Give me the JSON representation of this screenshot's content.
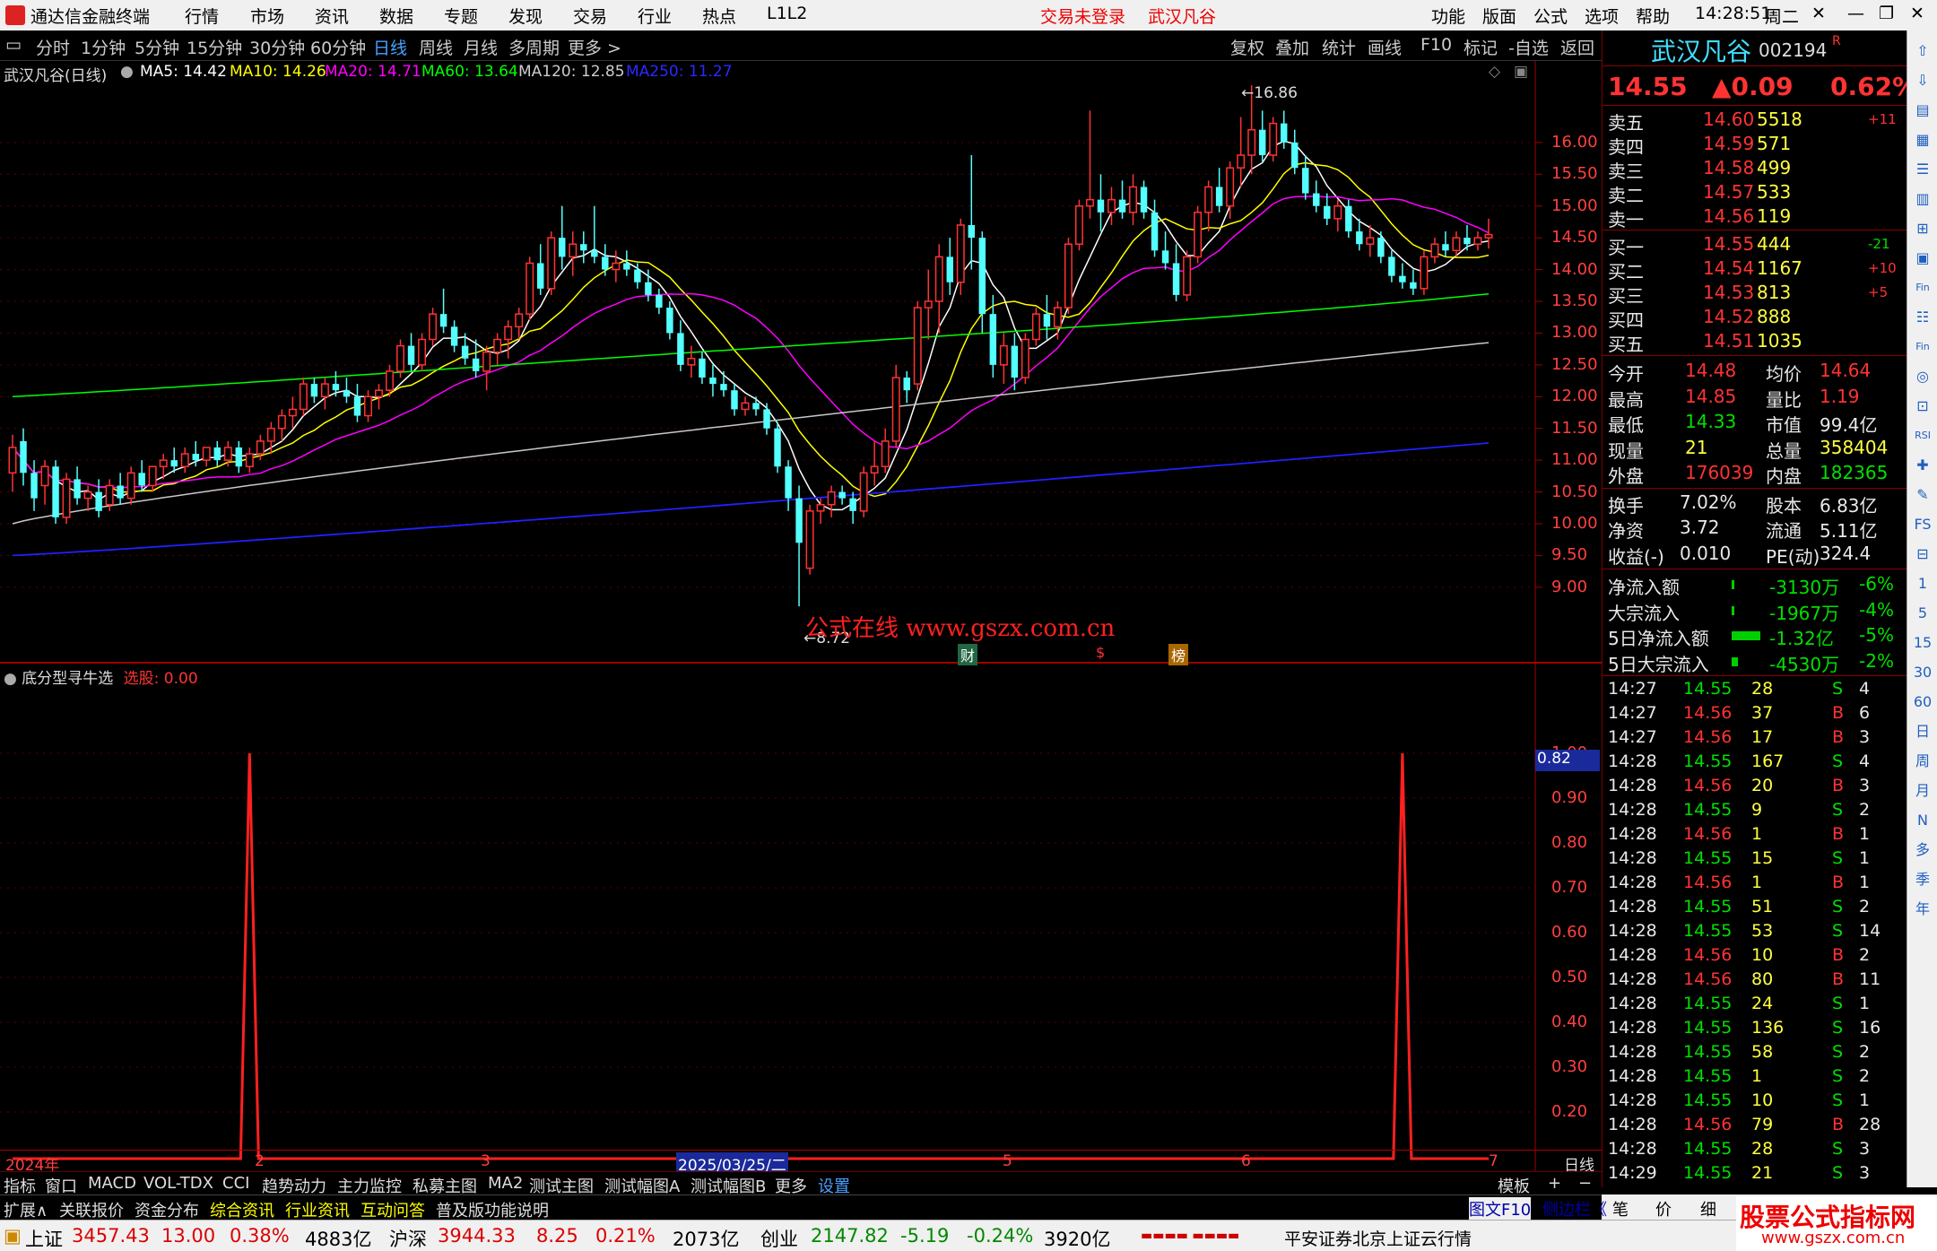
{
  "titlebar": {
    "app_name": "通达信金融终端",
    "menu": [
      "行情",
      "市场",
      "资讯",
      "数据",
      "专题",
      "发现",
      "交易",
      "行业",
      "热点",
      "L1L2"
    ],
    "login_status": "交易未登录",
    "stock_name": "武汉凡谷",
    "right_menu": [
      "功能",
      "版面",
      "公式",
      "选项",
      "帮助"
    ],
    "time": "14:28:51",
    "weekday": "周二"
  },
  "periodbar": {
    "items": [
      "分时",
      "1分钟",
      "5分钟",
      "15分钟",
      "30分钟",
      "60分钟",
      "日线",
      "周线",
      "月线",
      "多周期",
      "更多 >"
    ],
    "active": "日线",
    "right_items": [
      "复权",
      "叠加",
      "统计",
      "画线",
      "F10",
      "标记",
      "-自选",
      "返回"
    ]
  },
  "main_chart": {
    "label": "武汉凡谷(日线)",
    "ma": [
      {
        "text": "MA5: 14.42",
        "color": "#ffffff"
      },
      {
        "text": "MA10: 14.26",
        "color": "#ffff00"
      },
      {
        "text": "MA20: 14.71",
        "color": "#ff00ff"
      },
      {
        "text": "MA60: 13.64",
        "color": "#00ff00"
      },
      {
        "text": "MA120: 12.85",
        "color": "#c0c0c0"
      },
      {
        "text": "MA250: 11.27",
        "color": "#2020ff"
      }
    ],
    "high_label": "16.86",
    "low_label": "8.72",
    "watermark": "公式在线  www.gszx.com.cn",
    "markers": [
      "财",
      "$",
      "榜"
    ],
    "y_ticks": [
      "16.00",
      "15.50",
      "15.00",
      "14.50",
      "14.00",
      "13.50",
      "13.00",
      "12.50",
      "12.00",
      "11.50",
      "11.00",
      "10.50",
      "10.00",
      "9.50",
      "9.00"
    ],
    "candles": [
      [
        10.8,
        11.4,
        10.5,
        11.2
      ],
      [
        11.3,
        11.5,
        10.6,
        10.8
      ],
      [
        10.8,
        11.0,
        10.2,
        10.4
      ],
      [
        10.6,
        11.0,
        10.3,
        10.9
      ],
      [
        10.9,
        11.0,
        10.0,
        10.1
      ],
      [
        10.1,
        10.8,
        10.0,
        10.7
      ],
      [
        10.7,
        10.9,
        10.3,
        10.4
      ],
      [
        10.4,
        10.6,
        10.2,
        10.5
      ],
      [
        10.5,
        10.7,
        10.1,
        10.2
      ],
      [
        10.3,
        10.7,
        10.2,
        10.6
      ],
      [
        10.6,
        10.8,
        10.3,
        10.4
      ],
      [
        10.4,
        10.9,
        10.3,
        10.8
      ],
      [
        10.8,
        11.0,
        10.5,
        10.6
      ],
      [
        10.6,
        10.9,
        10.5,
        10.9
      ],
      [
        10.9,
        11.1,
        10.7,
        11.0
      ],
      [
        11.0,
        11.2,
        10.8,
        10.9
      ],
      [
        10.9,
        11.2,
        10.8,
        11.1
      ],
      [
        11.1,
        11.3,
        10.9,
        11.0
      ],
      [
        11.0,
        11.2,
        10.9,
        11.2
      ],
      [
        11.2,
        11.3,
        10.9,
        11.0
      ],
      [
        11.0,
        11.3,
        10.9,
        11.2
      ],
      [
        11.2,
        11.3,
        10.8,
        10.9
      ],
      [
        10.9,
        11.2,
        10.8,
        11.1
      ],
      [
        11.1,
        11.4,
        11.0,
        11.3
      ],
      [
        11.3,
        11.6,
        11.1,
        11.5
      ],
      [
        11.5,
        11.8,
        11.3,
        11.7
      ],
      [
        11.7,
        12.0,
        11.5,
        11.8
      ],
      [
        11.8,
        12.3,
        11.7,
        12.2
      ],
      [
        12.2,
        12.3,
        11.9,
        12.0
      ],
      [
        12.0,
        12.3,
        11.8,
        12.2
      ],
      [
        12.2,
        12.4,
        12.0,
        12.1
      ],
      [
        12.1,
        12.3,
        11.9,
        12.0
      ],
      [
        12.0,
        12.2,
        11.6,
        11.7
      ],
      [
        11.7,
        12.1,
        11.6,
        12.0
      ],
      [
        12.0,
        12.2,
        11.8,
        12.1
      ],
      [
        12.1,
        12.5,
        12.0,
        12.4
      ],
      [
        12.4,
        12.9,
        12.3,
        12.8
      ],
      [
        12.8,
        13.0,
        12.4,
        12.5
      ],
      [
        12.5,
        13.0,
        12.4,
        12.9
      ],
      [
        12.9,
        13.4,
        12.8,
        13.3
      ],
      [
        13.3,
        13.7,
        13.0,
        13.1
      ],
      [
        13.1,
        13.2,
        12.7,
        12.8
      ],
      [
        12.8,
        13.0,
        12.5,
        12.6
      ],
      [
        12.6,
        12.9,
        12.3,
        12.4
      ],
      [
        12.4,
        12.8,
        12.1,
        12.7
      ],
      [
        12.7,
        13.0,
        12.5,
        12.9
      ],
      [
        12.9,
        13.2,
        12.6,
        13.1
      ],
      [
        13.1,
        13.4,
        12.9,
        13.3
      ],
      [
        13.3,
        14.2,
        13.2,
        14.1
      ],
      [
        14.1,
        14.4,
        13.6,
        13.7
      ],
      [
        13.7,
        14.6,
        13.6,
        14.5
      ],
      [
        14.5,
        15.0,
        14.0,
        14.2
      ],
      [
        14.2,
        14.6,
        13.9,
        14.4
      ],
      [
        14.4,
        14.6,
        14.1,
        14.3
      ],
      [
        14.3,
        15.0,
        14.1,
        14.2
      ],
      [
        14.2,
        14.4,
        13.9,
        14.0
      ],
      [
        14.0,
        14.3,
        13.8,
        14.1
      ],
      [
        14.1,
        14.3,
        13.9,
        14.0
      ],
      [
        14.0,
        14.1,
        13.7,
        13.8
      ],
      [
        13.8,
        14.0,
        13.5,
        13.6
      ],
      [
        13.6,
        13.7,
        13.3,
        13.4
      ],
      [
        13.4,
        13.5,
        12.9,
        13.0
      ],
      [
        13.0,
        13.2,
        12.4,
        12.5
      ],
      [
        12.5,
        12.8,
        12.3,
        12.6
      ],
      [
        12.6,
        12.7,
        12.2,
        12.3
      ],
      [
        12.3,
        12.5,
        12.0,
        12.2
      ],
      [
        12.2,
        12.4,
        12.0,
        12.1
      ],
      [
        12.1,
        12.2,
        11.7,
        11.8
      ],
      [
        11.8,
        12.0,
        11.7,
        11.9
      ],
      [
        11.9,
        12.0,
        11.7,
        11.8
      ],
      [
        11.8,
        11.9,
        11.4,
        11.5
      ],
      [
        11.5,
        11.6,
        10.8,
        10.9
      ],
      [
        10.9,
        11.0,
        10.2,
        10.4
      ],
      [
        10.4,
        10.6,
        8.7,
        9.7
      ],
      [
        9.3,
        10.3,
        9.2,
        10.2
      ],
      [
        10.2,
        10.4,
        10.0,
        10.3
      ],
      [
        10.3,
        10.6,
        10.1,
        10.5
      ],
      [
        10.5,
        10.6,
        10.3,
        10.4
      ],
      [
        10.4,
        10.5,
        10.0,
        10.2
      ],
      [
        10.2,
        10.9,
        10.1,
        10.8
      ],
      [
        10.8,
        11.3,
        10.6,
        10.9
      ],
      [
        10.9,
        11.5,
        10.8,
        11.3
      ],
      [
        11.3,
        12.5,
        11.2,
        12.3
      ],
      [
        12.3,
        12.4,
        11.9,
        12.1
      ],
      [
        12.2,
        13.5,
        12.1,
        13.4
      ],
      [
        13.4,
        14.0,
        12.9,
        13.5
      ],
      [
        13.5,
        14.4,
        13.0,
        14.2
      ],
      [
        14.2,
        14.5,
        13.6,
        13.8
      ],
      [
        13.8,
        14.8,
        13.6,
        14.7
      ],
      [
        14.7,
        15.8,
        14.0,
        14.5
      ],
      [
        14.5,
        14.6,
        13.0,
        13.3
      ],
      [
        13.3,
        13.6,
        12.3,
        12.5
      ],
      [
        12.5,
        13.0,
        12.2,
        12.8
      ],
      [
        12.8,
        13.0,
        12.1,
        12.3
      ],
      [
        12.3,
        13.0,
        12.2,
        12.9
      ],
      [
        12.9,
        13.4,
        12.8,
        13.3
      ],
      [
        13.3,
        13.6,
        12.9,
        13.1
      ],
      [
        13.1,
        13.5,
        12.9,
        13.4
      ],
      [
        13.4,
        14.5,
        13.3,
        14.4
      ],
      [
        14.4,
        15.1,
        14.3,
        15.0
      ],
      [
        15.0,
        16.5,
        14.8,
        15.1
      ],
      [
        15.1,
        15.5,
        14.6,
        14.9
      ],
      [
        14.9,
        15.3,
        14.7,
        15.1
      ],
      [
        15.1,
        15.4,
        14.8,
        14.9
      ],
      [
        14.9,
        15.5,
        14.7,
        15.3
      ],
      [
        15.3,
        15.4,
        14.8,
        14.9
      ],
      [
        14.9,
        15.1,
        14.2,
        14.3
      ],
      [
        14.3,
        14.6,
        14.0,
        14.1
      ],
      [
        14.1,
        14.4,
        13.5,
        13.6
      ],
      [
        13.6,
        14.3,
        13.5,
        14.2
      ],
      [
        14.2,
        15.0,
        14.1,
        14.9
      ],
      [
        14.9,
        15.4,
        14.6,
        15.3
      ],
      [
        15.3,
        15.6,
        14.9,
        15.0
      ],
      [
        15.0,
        15.7,
        14.8,
        15.6
      ],
      [
        15.6,
        16.4,
        15.3,
        15.8
      ],
      [
        15.8,
        16.9,
        15.5,
        16.2
      ],
      [
        16.2,
        16.5,
        15.7,
        15.8
      ],
      [
        15.8,
        16.4,
        15.7,
        16.3
      ],
      [
        16.3,
        16.5,
        15.9,
        16.0
      ],
      [
        16.0,
        16.2,
        15.5,
        15.6
      ],
      [
        15.6,
        15.8,
        15.1,
        15.2
      ],
      [
        15.2,
        15.4,
        14.9,
        15.0
      ],
      [
        15.0,
        15.2,
        14.7,
        14.8
      ],
      [
        14.8,
        15.1,
        14.6,
        15.0
      ],
      [
        15.0,
        15.1,
        14.5,
        14.6
      ],
      [
        14.6,
        14.8,
        14.3,
        14.4
      ],
      [
        14.4,
        14.7,
        14.2,
        14.5
      ],
      [
        14.5,
        14.6,
        14.1,
        14.2
      ],
      [
        14.2,
        14.3,
        13.8,
        13.9
      ],
      [
        13.9,
        14.1,
        13.7,
        13.8
      ],
      [
        13.8,
        14.0,
        13.6,
        13.7
      ],
      [
        13.7,
        14.3,
        13.6,
        14.2
      ],
      [
        14.2,
        14.5,
        14.1,
        14.4
      ],
      [
        14.4,
        14.6,
        14.2,
        14.3
      ],
      [
        14.3,
        14.6,
        14.2,
        14.5
      ],
      [
        14.5,
        14.7,
        14.3,
        14.4
      ],
      [
        14.4,
        14.6,
        14.3,
        14.5
      ],
      [
        14.5,
        14.8,
        14.33,
        14.55
      ]
    ]
  },
  "indicator": {
    "label": "底分型寻牛选",
    "value_label": "选股: 0.00",
    "y_ticks": [
      "1.00",
      "0.90",
      "0.80",
      "0.70",
      "0.60",
      "0.50",
      "0.40",
      "0.30",
      "0.20"
    ],
    "cursor_value": "0.82",
    "spikes_at_candle": [
      22,
      129
    ]
  },
  "x_axis": {
    "labels": [
      "2024年",
      "2",
      "3",
      "2025/03/25/二",
      "5",
      "6",
      "7"
    ],
    "period": "日线"
  },
  "quote": {
    "name": "武汉凡谷",
    "code": "002194",
    "badge": "R",
    "price": "14.55",
    "change": "▲0.09",
    "pct": "0.62%",
    "asks": [
      {
        "label": "卖五",
        "price": "14.60",
        "vol": "5518",
        "chg": "+11"
      },
      {
        "label": "卖四",
        "price": "14.59",
        "vol": "571",
        "chg": ""
      },
      {
        "label": "卖三",
        "price": "14.58",
        "vol": "499",
        "chg": ""
      },
      {
        "label": "卖二",
        "price": "14.57",
        "vol": "533",
        "chg": ""
      },
      {
        "label": "卖一",
        "price": "14.56",
        "vol": "119",
        "chg": ""
      }
    ],
    "bids": [
      {
        "label": "买一",
        "price": "14.55",
        "vol": "444",
        "chg": "-21"
      },
      {
        "label": "买二",
        "price": "14.54",
        "vol": "1167",
        "chg": "+10"
      },
      {
        "label": "买三",
        "price": "14.53",
        "vol": "813",
        "chg": "+5"
      },
      {
        "label": "买四",
        "price": "14.52",
        "vol": "888",
        "chg": ""
      },
      {
        "label": "买五",
        "price": "14.51",
        "vol": "1035",
        "chg": ""
      }
    ],
    "stats": [
      [
        {
          "l": "今开",
          "v": "14.48",
          "c": "red"
        },
        {
          "l": "均价",
          "v": "14.64",
          "c": "red"
        }
      ],
      [
        {
          "l": "最高",
          "v": "14.85",
          "c": "red"
        },
        {
          "l": "量比",
          "v": "1.19",
          "c": "red"
        }
      ],
      [
        {
          "l": "最低",
          "v": "14.33",
          "c": "green"
        },
        {
          "l": "市值",
          "v": "99.4亿",
          "c": "white"
        }
      ],
      [
        {
          "l": "现量",
          "v": "21",
          "c": "yellow"
        },
        {
          "l": "总量",
          "v": "358404",
          "c": "yellow"
        }
      ],
      [
        {
          "l": "外盘",
          "v": "176039",
          "c": "red"
        },
        {
          "l": "内盘",
          "v": "182365",
          "c": "green"
        }
      ]
    ],
    "stats2": [
      [
        {
          "l": "换手",
          "v": "7.02%"
        },
        {
          "l": "股本",
          "v": "6.83亿"
        }
      ],
      [
        {
          "l": "净资",
          "v": "3.72"
        },
        {
          "l": "流通",
          "v": "5.11亿"
        }
      ],
      [
        {
          "l": "收益(-)",
          "v": "0.010"
        },
        {
          "l": "PE(动)",
          "v": "324.4"
        }
      ]
    ],
    "flows": [
      {
        "l": "净流入额",
        "v": "-3130万",
        "p": "-6%",
        "bar": 0.03
      },
      {
        "l": "大宗流入",
        "v": "-1967万",
        "p": "-4%",
        "bar": 0.02
      },
      {
        "l": "5日净流入额",
        "v": "-1.32亿",
        "p": "-5%",
        "bar": 0.9
      },
      {
        "l": "5日大宗流入",
        "v": "-4530万",
        "p": "-2%",
        "bar": 0.2
      }
    ],
    "ticks": [
      [
        "14:27",
        "14.55",
        "28",
        "S",
        "4"
      ],
      [
        "14:27",
        "14.56",
        "37",
        "B",
        "6"
      ],
      [
        "14:27",
        "14.56",
        "17",
        "B",
        "3"
      ],
      [
        "14:28",
        "14.55",
        "167",
        "S",
        "4"
      ],
      [
        "14:28",
        "14.56",
        "20",
        "B",
        "3"
      ],
      [
        "14:28",
        "14.55",
        "9",
        "S",
        "2"
      ],
      [
        "14:28",
        "14.56",
        "1",
        "B",
        "1"
      ],
      [
        "14:28",
        "14.55",
        "15",
        "S",
        "1"
      ],
      [
        "14:28",
        "14.56",
        "1",
        "B",
        "1"
      ],
      [
        "14:28",
        "14.55",
        "51",
        "S",
        "2"
      ],
      [
        "14:28",
        "14.55",
        "53",
        "S",
        "14"
      ],
      [
        "14:28",
        "14.56",
        "10",
        "B",
        "2"
      ],
      [
        "14:28",
        "14.56",
        "80",
        "B",
        "11"
      ],
      [
        "14:28",
        "14.55",
        "24",
        "S",
        "1"
      ],
      [
        "14:28",
        "14.55",
        "136",
        "S",
        "16"
      ],
      [
        "14:28",
        "14.55",
        "58",
        "S",
        "2"
      ],
      [
        "14:28",
        "14.55",
        "1",
        "S",
        "2"
      ],
      [
        "14:28",
        "14.55",
        "10",
        "S",
        "1"
      ],
      [
        "14:28",
        "14.56",
        "79",
        "B",
        "28"
      ],
      [
        "14:28",
        "14.55",
        "28",
        "S",
        "3"
      ],
      [
        "14:29",
        "14.55",
        "21",
        "S",
        "3"
      ]
    ]
  },
  "tabs": {
    "row1": [
      "指标",
      "窗口",
      "MACD",
      "VOL-TDX",
      "CCI",
      "趋势动力",
      "主力监控",
      "私募主图",
      "MA2",
      "测试主图",
      "测试幅图A",
      "测试幅图B",
      "更多",
      "设置"
    ],
    "row1_right": [
      "模板",
      "+",
      "−"
    ],
    "row2": [
      "扩展∧",
      "关联报价",
      "资金分布",
      "综合资讯",
      "行业资讯",
      "互动问答",
      "普及版功能说明"
    ],
    "rtabs": [
      "图文F10",
      "侧边栏《",
      "笔",
      "价",
      "细"
    ]
  },
  "status": {
    "sh_label": "上证",
    "sh": "3457.43",
    "sh_chg": "13.00",
    "sh_pct": "0.38%",
    "sh_amt": "4883亿",
    "hs_label": "沪深",
    "hs": "3944.33",
    "hs_chg": "8.25",
    "hs_pct": "0.21%",
    "hs_amt": "2073亿",
    "cy_label": "创业",
    "cy": "2147.82",
    "cy_chg": "-5.19",
    "cy_pct": "-0.24%",
    "cy_amt": "3920亿",
    "server": "平安证券北京上证云行情"
  },
  "brand": {
    "line1": "股票公式指标网",
    "line2": "www.gszx.com.cn"
  },
  "right_toolbar": [
    "⇧",
    "⇩",
    "▤",
    "▦",
    "☰",
    "▥",
    "⊞",
    "▣",
    "Fin",
    "☷",
    "Fin",
    "◎",
    "⊡",
    "RSI",
    "✚",
    "✎",
    "FS",
    "⊟",
    "1",
    "5",
    "15",
    "30",
    "60",
    "日",
    "周",
    "月",
    "N",
    "多",
    "季",
    "年"
  ]
}
